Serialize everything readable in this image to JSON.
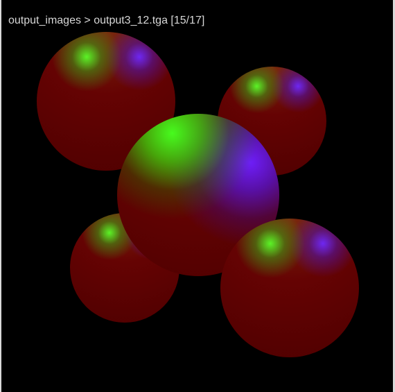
{
  "viewer": {
    "caption": "output_images > output3_12.tga [15/17]"
  }
}
